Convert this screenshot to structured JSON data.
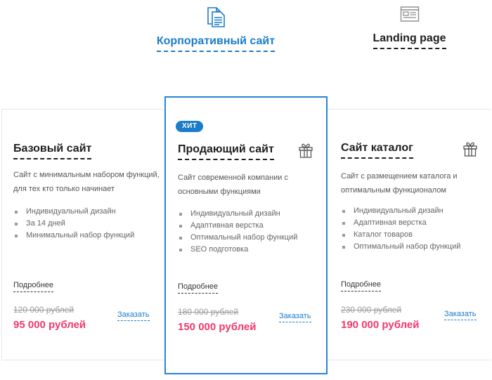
{
  "tabs": {
    "corporate": {
      "label": "Корпоративный сайт",
      "icon": "documents-icon",
      "active": true
    },
    "landing": {
      "label": "Landing page",
      "icon": "webpage-icon",
      "active": false
    }
  },
  "colors": {
    "accent": "#1a7ccb",
    "price": "#f0386b",
    "active_border": "#2684d8"
  },
  "cards": {
    "base": {
      "title": "Базовый сайт",
      "desc_line1": "Сайт с минимальным набором функций,",
      "desc_line2": "для тех кто только начинает",
      "features": [
        "Индивидуальный дизайн",
        "За 14 дней",
        "Минимальный набор функций"
      ],
      "details": "Подробнее",
      "old_price": "120 000 рублей",
      "price": "95 000 рублей",
      "order": "Заказать"
    },
    "selling": {
      "badge": "ХИТ",
      "title": "Продающий сайт",
      "icon": "gift-icon",
      "desc_line1": "Сайт современной компании с",
      "desc_line2": "основными функциями",
      "features": [
        "Индивидуальный дизайн",
        "Адаптивная верстка",
        "Оптимальный набор функций",
        "SEO подготовка"
      ],
      "details": "Подробнее",
      "old_price": "180 000 рублей",
      "price": "150 000 рублей",
      "order": "Заказать"
    },
    "catalog": {
      "title": "Сайт каталог",
      "icon": "gift-icon",
      "desc_line1": "Сайт с размещением каталога и",
      "desc_line2": "оптимальным функционалом",
      "features": [
        "Индивидуальный дизайн",
        "Адаптивная верстка",
        "Каталог товаров",
        "Оптимальный набор функций"
      ],
      "details": "Подробнее",
      "old_price": "230 000 рублей",
      "price": "190 000 рублей",
      "order": "Заказать"
    }
  }
}
